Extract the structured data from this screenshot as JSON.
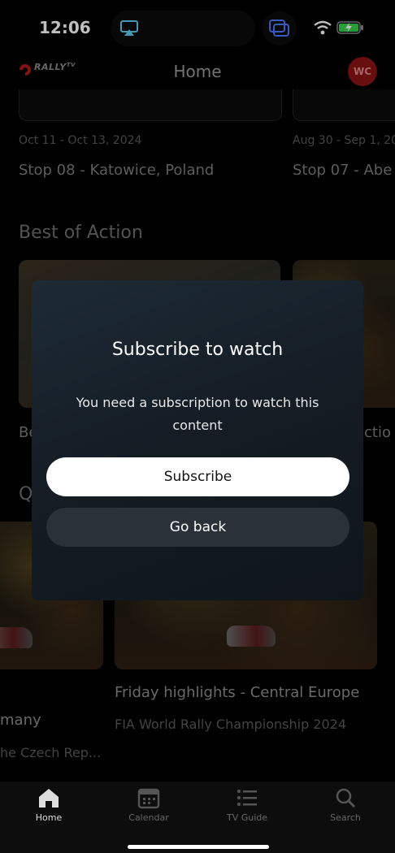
{
  "status_bar": {
    "time": "12:06"
  },
  "header": {
    "logo_text": "RALLY",
    "logo_suffix": "TV",
    "title": "Home",
    "avatar_initials": "WC"
  },
  "stops_row": [
    {
      "dates": "Oct 11 - Oct 13, 2024",
      "title": "Stop 08 - Katowice, Poland"
    },
    {
      "dates": "Aug 30 - Sep 1, 20",
      "title": "Stop 07 - Abe"
    }
  ],
  "best_of_action": {
    "title": "Best of Action",
    "items": [
      {
        "title": "Be"
      },
      {
        "title": "ctio"
      }
    ]
  },
  "section_q": {
    "title": "Q"
  },
  "highlights_row": [
    {
      "title": "many",
      "subtitle": "he Czech Rep..."
    },
    {
      "title": "Friday highlights - Central Europe",
      "subtitle": "FIA World Rally Championship 2024"
    }
  ],
  "modal": {
    "title": "Subscribe to watch",
    "body": "You need a subscription to watch this content",
    "subscribe_label": "Subscribe",
    "back_label": "Go back"
  },
  "nav": {
    "items": [
      {
        "label": "Home",
        "icon": "home-icon",
        "active": true
      },
      {
        "label": "Calendar",
        "icon": "calendar-icon",
        "active": false
      },
      {
        "label": "TV Guide",
        "icon": "list-icon",
        "active": false
      },
      {
        "label": "Search",
        "icon": "search-icon",
        "active": false
      }
    ]
  },
  "colors": {
    "accent": "#c21a1a",
    "modal_bg": "#18222c",
    "button_secondary": "#2a3139"
  }
}
